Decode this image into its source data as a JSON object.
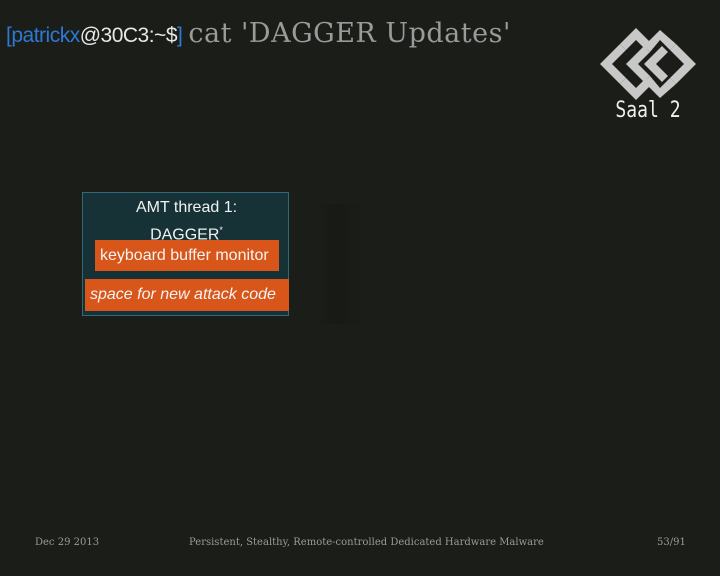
{
  "terminal": {
    "bracket_open": "[",
    "user": "patrickx",
    "host_path": "@30C3:~$",
    "bracket_close": "]",
    "command": "cat 'DAGGER Updates'"
  },
  "logo": {
    "icon": "30c3-logo-icon",
    "room": "Saal 2"
  },
  "amt_box": {
    "title_line1": "AMT thread 1:",
    "title_line2": "DAGGER",
    "title_marker": "*",
    "modules": [
      "keyboard buffer monitor",
      "space for new attack code"
    ]
  },
  "footer": {
    "date": "Dec 29  2013",
    "title": "Persistent, Stealthy, Remote-controlled Dedicated Hardware Malware",
    "page": "53/91"
  },
  "colors": {
    "background": "#1b1d19",
    "prompt_blue": "#2f78d4",
    "box_fill": "#163236",
    "box_border": "#2f6a78",
    "module_orange": "#d8561a"
  }
}
